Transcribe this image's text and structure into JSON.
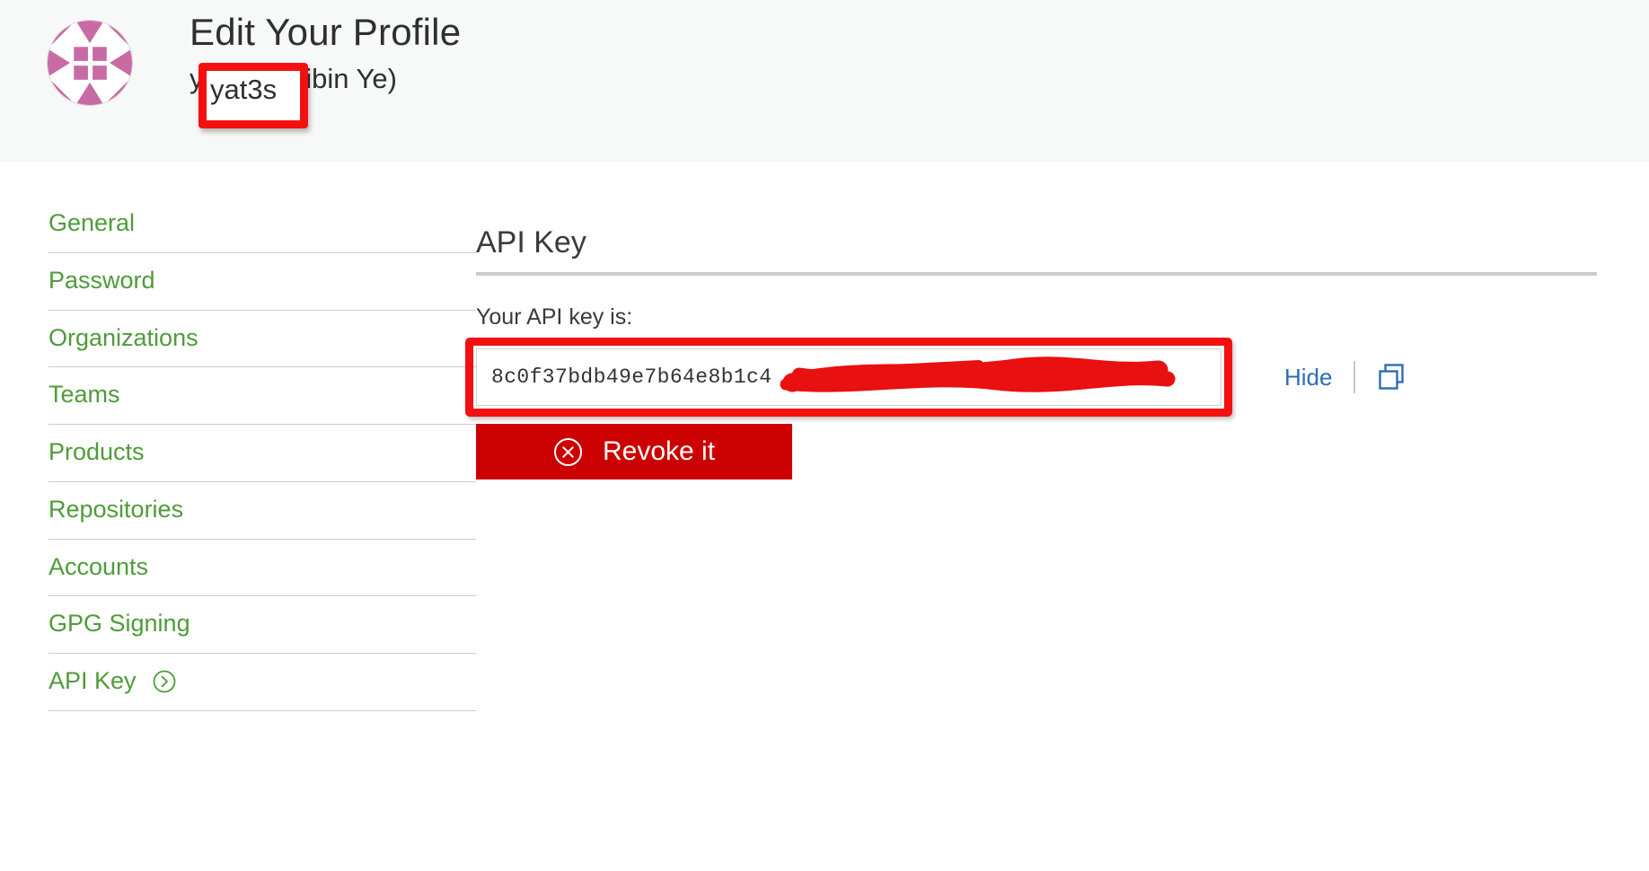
{
  "header": {
    "title": "Edit Your Profile",
    "username": "yat3s",
    "fullname": "(Zhibin Ye)",
    "subtitle": "yat3s (Zhibin Ye)",
    "avatar_icon": "identicon-avatar",
    "avatar_colors": [
      "#c86ba5",
      "#ffffff"
    ],
    "background": "#f7f8f8"
  },
  "sidebar": {
    "items": [
      {
        "label": "General",
        "arrow": false
      },
      {
        "label": "Password",
        "arrow": false
      },
      {
        "label": "Organizations",
        "arrow": false
      },
      {
        "label": "Teams",
        "arrow": false
      },
      {
        "label": "Products",
        "arrow": false
      },
      {
        "label": "Repositories",
        "arrow": false
      },
      {
        "label": "Accounts",
        "arrow": false
      },
      {
        "label": "GPG Signing",
        "arrow": false
      },
      {
        "label": "API Key",
        "arrow": true
      }
    ],
    "link_color": "#4f9b39",
    "divider_color": "#c9cccd"
  },
  "main": {
    "section_title": "API Key",
    "field_label": "Your API key is:",
    "api_key_value": "8c0f37bdb49e7b64e8b1c4",
    "api_key_visible_prefix": "8c0f37bdb49e7b64e8b1c4",
    "api_key_redacted": true,
    "hide_label": "Hide",
    "hide_color": "#2d6cb5",
    "copy_icon": "copy-icon",
    "revoke_label": "Revoke it",
    "revoke_icon": "x-circle-icon",
    "revoke_color": "#cc0000"
  },
  "annotations": {
    "color": "#f41010",
    "username_box": "highlights the username yat3s",
    "api_key_box": "highlights the API key input field",
    "api_key_scribble": "red scribble redacting the API key suffix"
  }
}
